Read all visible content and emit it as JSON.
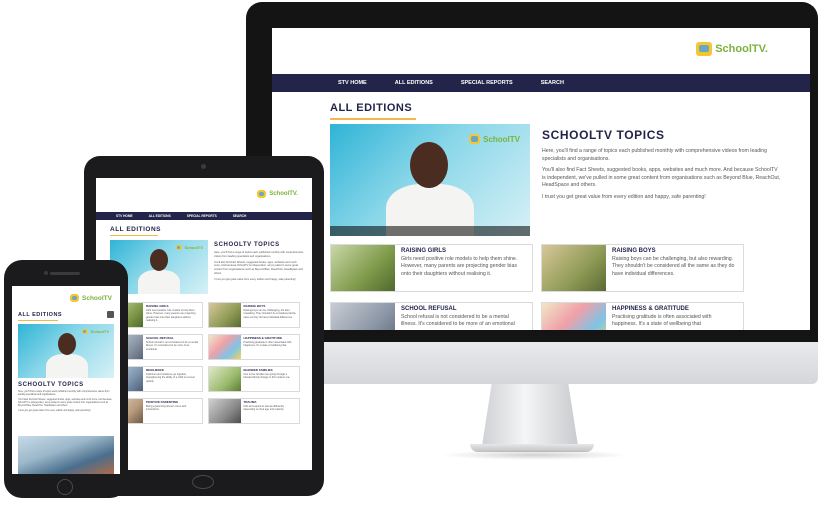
{
  "site": {
    "logo_text": "SchoolTV",
    "logo_text_small": "SchoolTV.",
    "nav": [
      "STV HOME",
      "ALL EDITIONS",
      "SPECIAL REPORTS",
      "SEARCH"
    ],
    "page_title": "ALL EDITIONS",
    "video_logo": "SchoolTV",
    "topics": {
      "title": "SCHOOLTV TOPICS",
      "paragraphs": [
        "Here, you'll find a range of topics each published monthly with comprehensive videos from leading specialists and organisations.",
        "You'll also find Fact Sheets, suggested books, apps, websites and much more. And because SchoolTV is independent, we've pulled in some great content from organisations such as Beyond Blue, ReachOut, HeadSpace and others.",
        "I trust you get great value from every edition and happy, safe parenting!"
      ]
    },
    "cards": [
      {
        "title": "RAISING GIRLS",
        "desc": "Girls need positive role models to help them shine. However, many parents are projecting gender bias onto their daughters without realising it."
      },
      {
        "title": "RAISING BOYS",
        "desc": "Raising boys can be challenging, but also rewarding. They shouldn't be considered all the same as they do have individual differences."
      },
      {
        "title": "SCHOOL REFUSAL",
        "desc": "School refusal is not considered to be a mental illness. It's considered to be more of an emotional"
      },
      {
        "title": "HAPPINESS & GRATITUDE",
        "desc": "Practising gratitude is often associated with happiness. It's a state of wellbeing that"
      }
    ],
    "extra_cards": [
      {
        "title": "RESILIENCE",
        "desc": "Optimism and resilience go together, strengthening the ability of a child to recover quickly."
      },
      {
        "title": "BLENDED FAMILIES",
        "desc": "One in five families are going through a blended family change in this modern era."
      },
      {
        "title": "POSITIVE PARENTING",
        "desc": "Being a parenting doesn't come with instructions."
      },
      {
        "title": "TRAUMA",
        "desc": "Kids all respond to trauma differently depending on their age and maturity."
      }
    ]
  },
  "colors": {
    "nav_bg": "#23244a",
    "accent_underline": "#f2b84b",
    "logo_green": "#7bb23a",
    "logo_yellow": "#f6c630"
  }
}
